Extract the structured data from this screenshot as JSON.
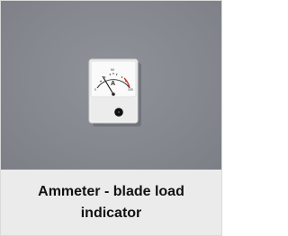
{
  "product": {
    "caption": "Ammeter - blade load indicator",
    "image_icon": "ammeter-icon",
    "meter_unit_symbol": "A",
    "background_color": "#85898f",
    "caption_background_color": "#ebebeb"
  }
}
